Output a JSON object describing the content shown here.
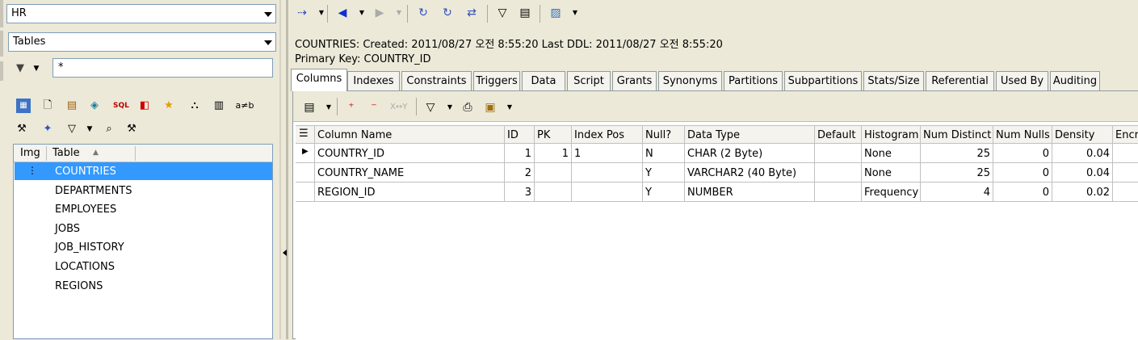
{
  "left": {
    "schema_combo": "HR",
    "type_combo": "Tables",
    "filter_value": "*",
    "list_header": {
      "img": "Img",
      "table": "Table"
    },
    "tables": [
      "COUNTRIES",
      "DEPARTMENTS",
      "EMPLOYEES",
      "JOBS",
      "JOB_HISTORY",
      "LOCATIONS",
      "REGIONS"
    ],
    "selected": "COUNTRIES",
    "toolbar_text": "a≠b"
  },
  "info": {
    "line1": "COUNTRIES:  Created: 2011/08/27 오전 8:55:20   Last DDL: 2011/08/27 오전 8:55:20",
    "line2": "Primary Key:  COUNTRY_ID"
  },
  "tabs": [
    "Columns",
    "Indexes",
    "Constraints",
    "Triggers",
    "Data",
    "Script",
    "Grants",
    "Synonyms",
    "Partitions",
    "Subpartitions",
    "Stats/Size",
    "Referential",
    "Used By",
    "Auditing"
  ],
  "grid": {
    "headers": [
      "Column Name",
      "ID",
      "PK",
      "Index Pos",
      "Null?",
      "Data Type",
      "Default",
      "Histogram",
      "Num Distinct",
      "Num Nulls",
      "Density",
      "Encr"
    ],
    "rows": [
      [
        "COUNTRY_ID",
        "1",
        "1",
        "1",
        "N",
        "CHAR (2 Byte)",
        "",
        "None",
        "25",
        "0",
        "0.04",
        ""
      ],
      [
        "COUNTRY_NAME",
        "2",
        "",
        "",
        "Y",
        "VARCHAR2 (40 Byte)",
        "",
        "None",
        "25",
        "0",
        "0.04",
        ""
      ],
      [
        "REGION_ID",
        "3",
        "",
        "",
        "Y",
        "NUMBER",
        "",
        "Frequency",
        "4",
        "0",
        "0.02",
        ""
      ]
    ]
  },
  "colors": {
    "selection": "#3399ff",
    "panel_bg": "#ece9d8",
    "border": "#7f9db9"
  }
}
